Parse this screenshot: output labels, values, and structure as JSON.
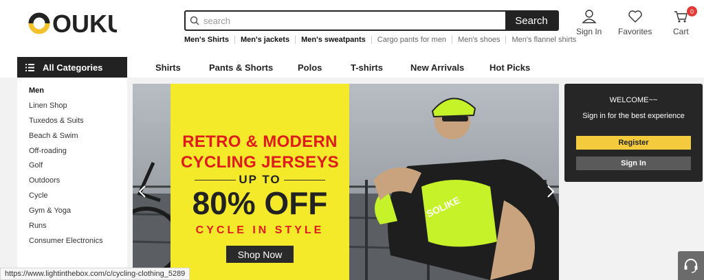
{
  "brand": {
    "logo_text": "OUKU",
    "logo_accent": "#f4c22b"
  },
  "search": {
    "placeholder": "search",
    "button_label": "Search"
  },
  "hot_searches": [
    {
      "label": "Men's Shirts",
      "bold": true
    },
    {
      "label": "Men's jackets",
      "bold": true
    },
    {
      "label": "Men's sweatpants",
      "bold": true
    },
    {
      "label": "Cargo pants for men",
      "bold": false
    },
    {
      "label": "Men's shoes",
      "bold": false
    },
    {
      "label": "Men's flannel shirts",
      "bold": false
    }
  ],
  "header_actions": {
    "sign_in": "Sign In",
    "favorites": "Favorites",
    "cart": "Cart",
    "cart_count": "0"
  },
  "nav": {
    "all_categories": "All Categories",
    "items": [
      "Shirts",
      "Pants & Shorts",
      "Polos",
      "T-shirts",
      "New Arrivals",
      "Hot Picks"
    ]
  },
  "sidebar": {
    "items": [
      "Men",
      "Linen Shop",
      "Tuxedos & Suits",
      "Beach & Swim",
      "Off-roading",
      "Golf",
      "Outdoors",
      "Cycle",
      "Gym & Yoga",
      "Runs",
      "Consumer Electronics"
    ]
  },
  "banner": {
    "headline_line1": "RETRO & MODERN",
    "headline_line2": "CYCLING JERSEYS",
    "up_to": "UP TO",
    "discount": "80% OFF",
    "tagline": "CYCLE IN STYLE",
    "cta": "Shop Now",
    "jersey_text": "SOLIKE",
    "colors": {
      "panel": "#f4ea2a",
      "headline": "#e01b1b",
      "neon": "#c6f22a"
    }
  },
  "welcome_card": {
    "title": "WELCOME~~",
    "subtitle": "Sign in for the best experience",
    "register": "Register",
    "sign_in": "Sign In"
  },
  "status_url": "https://www.lightinthebox.com/c/cycling-clothing_5289"
}
